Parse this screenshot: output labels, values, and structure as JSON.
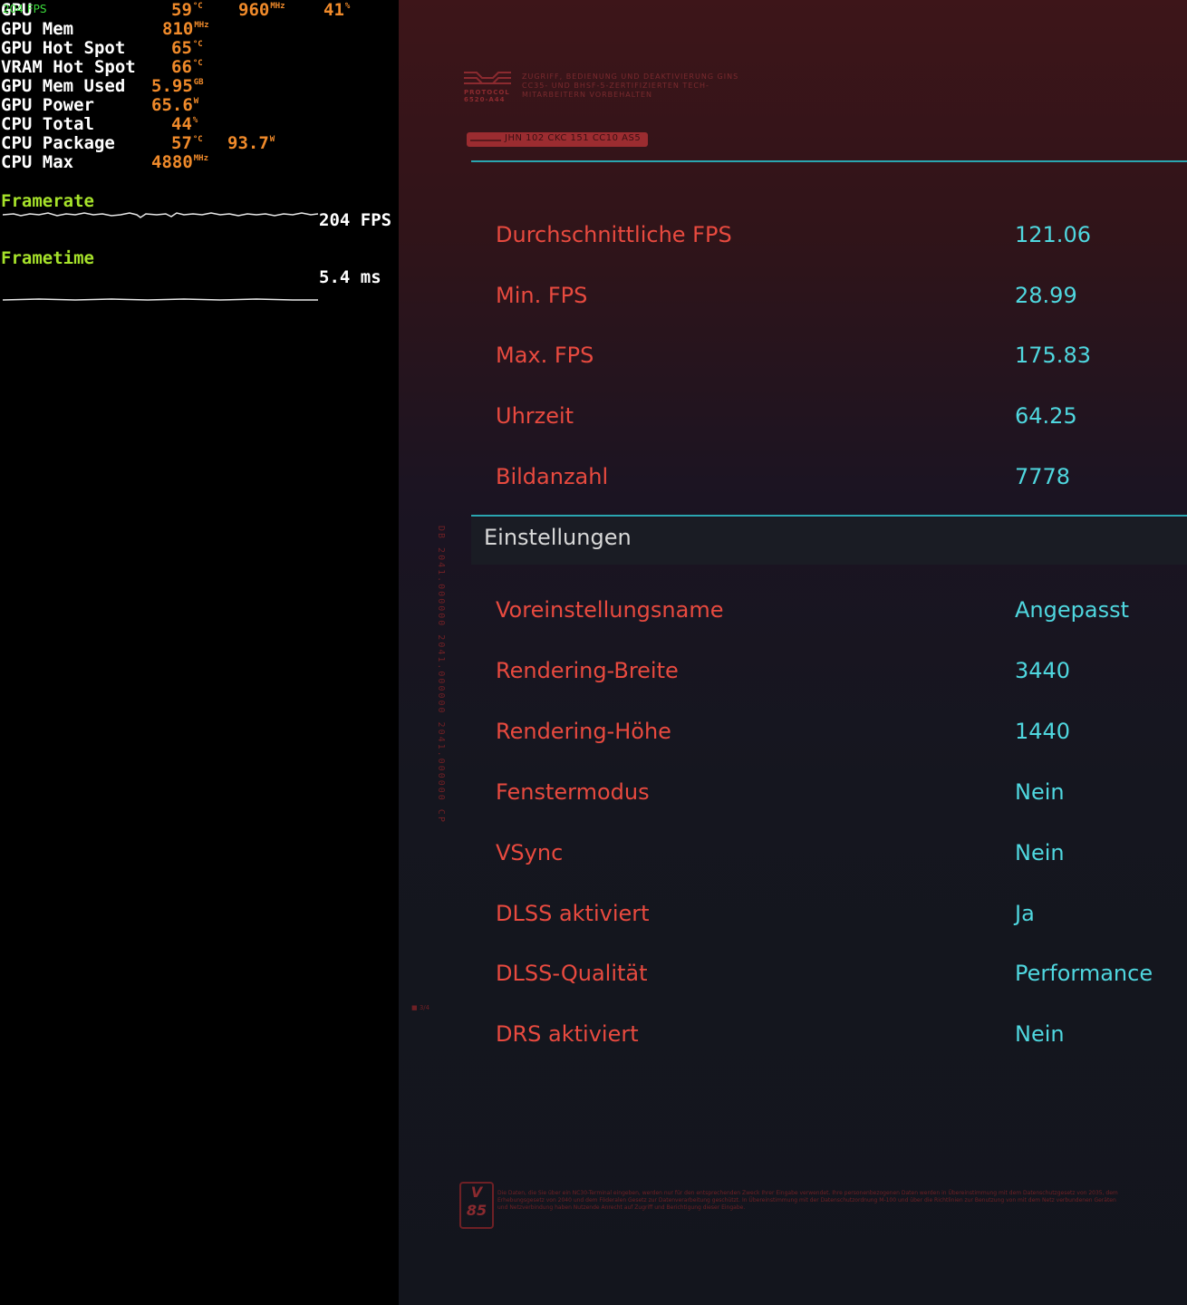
{
  "osd": {
    "fps_tag": "204 FPS",
    "rows": [
      {
        "label": "GPU",
        "values": [
          {
            "v": "59",
            "u": "°C"
          },
          {
            "v": "960",
            "u": "MHz"
          },
          {
            "v": "41",
            "u": "%"
          }
        ]
      },
      {
        "label": "GPU Mem",
        "values": [
          {
            "v": "810",
            "u": "MHz"
          }
        ]
      },
      {
        "label": "GPU Hot Spot",
        "values": [
          {
            "v": "65",
            "u": "°C"
          }
        ]
      },
      {
        "label": "VRAM Hot Spot",
        "values": [
          {
            "v": "66",
            "u": "°C"
          }
        ]
      },
      {
        "label": "GPU Mem Used",
        "values": [
          {
            "v": "5.95",
            "u": "GB"
          }
        ]
      },
      {
        "label": "GPU Power",
        "values": [
          {
            "v": "65.6",
            "u": "W"
          }
        ]
      },
      {
        "label": "CPU Total",
        "values": [
          {
            "v": "44",
            "u": "%"
          }
        ]
      },
      {
        "label": "CPU Package",
        "values": [
          {
            "v": "57",
            "u": "°C"
          },
          {
            "v": "93.7",
            "u": "W"
          }
        ]
      },
      {
        "label": "CPU Max",
        "values": [
          {
            "v": "4880",
            "u": "MHz"
          }
        ]
      }
    ],
    "framerate_label": "Framerate",
    "framerate_value": "204 FPS",
    "frametime_label": "Frametime",
    "frametime_value": "5.4 ms"
  },
  "panel": {
    "protocol_label": "PROTOCOL",
    "protocol_code": "6520-A44",
    "protocol_desc": "ZUGRIFF, BEDIENUNG UND DEAKTIVIERUNG GINS CC35- UND BHSF-5-ZERTIFIZIERTEN TECH-MITARBEITERN VORBEHALTEN",
    "code_pill": "JHN 102 CKC 151 CC10 AS5",
    "results": [
      {
        "label": "Durchschnittliche FPS",
        "value": "121.06"
      },
      {
        "label": "Min. FPS",
        "value": "28.99"
      },
      {
        "label": "Max. FPS",
        "value": "175.83"
      },
      {
        "label": "Uhrzeit",
        "value": "64.25"
      },
      {
        "label": "Bildanzahl",
        "value": "7778"
      }
    ],
    "section_title": "Einstellungen",
    "settings": [
      {
        "label": "Voreinstellungsname",
        "value": "Angepasst"
      },
      {
        "label": "Rendering-Breite",
        "value": "3440"
      },
      {
        "label": "Rendering-Höhe",
        "value": "1440"
      },
      {
        "label": "Fenstermodus",
        "value": "Nein"
      },
      {
        "label": "VSync",
        "value": "Nein"
      },
      {
        "label": "DLSS aktiviert",
        "value": "Ja"
      },
      {
        "label": "DLSS-Qualität",
        "value": "Performance"
      },
      {
        "label": "DRS aktiviert",
        "value": "Nein"
      }
    ],
    "vertical_text": "DB 2041.000000 2041.000000 2041.000000 CP",
    "tiny_mark": "■ 3/4",
    "badge": "V 85",
    "footer": "Die Daten, die Sie über ein NC30-Terminal eingeben, werden nur für den entsprechenden Zweck Ihrer Eingabe verwendet. Ihre personenbezogenen Daten werden in Übereinstimmung mit dem Datenschutzgesetz von 2035, dem Erhebungsgesetz von 2040 und dem Föderalen Gesetz zur Datenverarbeitung geschützt. In Übereinstimmung mit der Datenschutzordnung M-100 und über die Richtlinien zur Benutzung von mit dem Netz verbundenen Geräten und Netzverbindung haben Nutzende Anrecht auf Zugriff und Berichtigung dieser Eingabe."
  }
}
